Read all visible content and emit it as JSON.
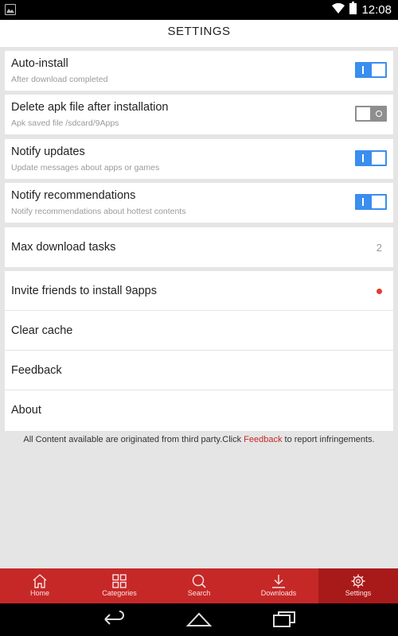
{
  "status_bar": {
    "time": "12:08",
    "icons": [
      "image-notification-icon",
      "wifi-icon",
      "battery-icon"
    ]
  },
  "header": {
    "title": "SETTINGS"
  },
  "toggles": [
    {
      "label": "Auto-install",
      "subtitle": "After download completed",
      "enabled": true
    },
    {
      "label": "Delete apk file after installation",
      "subtitle": "Apk saved file /sdcard/9Apps",
      "enabled": false
    },
    {
      "label": "Notify updates",
      "subtitle": "Update messages about apps or games",
      "enabled": true
    },
    {
      "label": "Notify recommendations",
      "subtitle": "Notify recommendations about hottest contents",
      "enabled": true
    }
  ],
  "max_download": {
    "label": "Max download tasks",
    "value": "2"
  },
  "menu": {
    "invite": "Invite friends to install 9apps",
    "clear_cache": "Clear cache",
    "feedback": "Feedback",
    "about": "About"
  },
  "footer": {
    "text_before": "All Content available are originated from third party.Click ",
    "link": "Feedback",
    "text_after": " to report infringements."
  },
  "bottom_nav": [
    {
      "label": "Home",
      "icon": "home-icon",
      "active": false
    },
    {
      "label": "Categories",
      "icon": "categories-icon",
      "active": false
    },
    {
      "label": "Search",
      "icon": "search-icon",
      "active": false
    },
    {
      "label": "Downloads",
      "icon": "download-icon",
      "active": false
    },
    {
      "label": "Settings",
      "icon": "gear-icon",
      "active": true
    }
  ],
  "colors": {
    "accent": "#c62828",
    "toggle_on": "#3a8ef0",
    "toggle_off": "#8e8e8e",
    "background": "#e5e5e5",
    "dot": "#e53935"
  }
}
